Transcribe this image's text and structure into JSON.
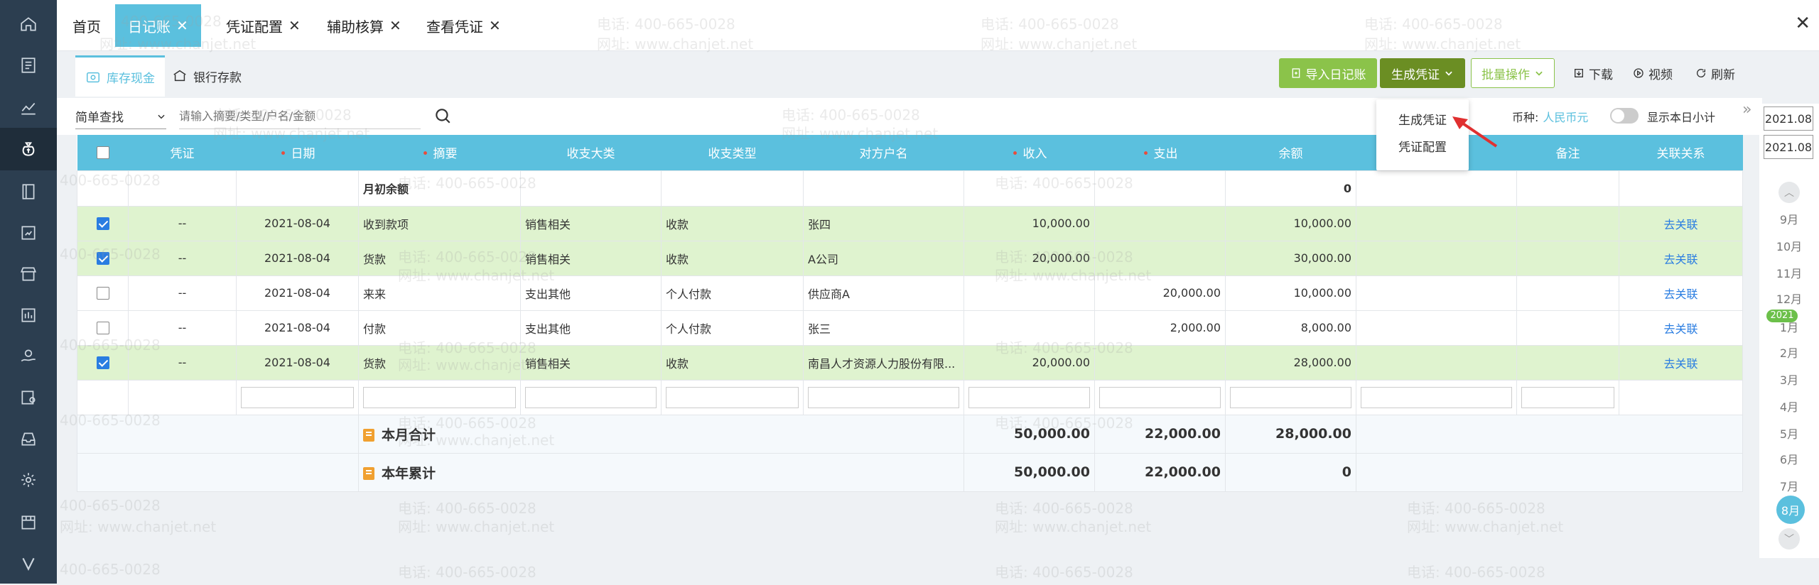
{
  "sidebar": {
    "items": [
      {
        "name": "home-icon"
      },
      {
        "name": "ledger-icon"
      },
      {
        "name": "chart-icon"
      },
      {
        "name": "money-bag-icon"
      },
      {
        "name": "book-icon"
      },
      {
        "name": "report-icon"
      },
      {
        "name": "store-icon"
      },
      {
        "name": "invoice-icon"
      },
      {
        "name": "hand-coin-icon"
      },
      {
        "name": "asset-icon"
      },
      {
        "name": "inbox-icon"
      },
      {
        "name": "gear-icon"
      },
      {
        "name": "film-icon"
      },
      {
        "name": "v-logo-icon"
      }
    ]
  },
  "tabs": [
    {
      "label": "首页",
      "closable": false
    },
    {
      "label": "日记账",
      "closable": true,
      "active": true
    },
    {
      "label": "凭证配置",
      "closable": true
    },
    {
      "label": "辅助核算",
      "closable": true
    },
    {
      "label": "查看凭证",
      "closable": true
    }
  ],
  "close_glyph": "✕",
  "subtabs": {
    "cash": "库存现金",
    "bank": "银行存款"
  },
  "toolbar": {
    "import": "导入日记账",
    "generate": "生成凭证",
    "batch": "批量操作",
    "download": "下载",
    "video": "视频",
    "refresh": "刷新"
  },
  "dropdown": {
    "items": [
      "生成凭证",
      "凭证配置"
    ]
  },
  "search": {
    "type": "简单查找",
    "placeholder": "请输入摘要/类型/户名/金额"
  },
  "currency": {
    "label": "币种:",
    "value": "人民币元"
  },
  "toggle_label": "显示本日小计",
  "table": {
    "headers": {
      "voucher": "凭证",
      "date": "日期",
      "summary": "摘要",
      "category": "收支大类",
      "type": "收支类型",
      "party": "对方户名",
      "income": "收入",
      "expense": "支出",
      "balance": "余额",
      "note": "备注",
      "relation": "关联关系"
    },
    "opening": {
      "label": "月初余额",
      "balance": "0"
    },
    "rows": [
      {
        "checked": true,
        "voucher": "--",
        "date": "2021-08-04",
        "summary": "收到款项",
        "category": "销售相关",
        "type": "收款",
        "party": "张四",
        "income": "10,000.00",
        "expense": "",
        "balance": "10,000.00",
        "relation": "去关联"
      },
      {
        "checked": true,
        "voucher": "--",
        "date": "2021-08-04",
        "summary": "货款",
        "category": "销售相关",
        "type": "收款",
        "party": "A公司",
        "income": "20,000.00",
        "expense": "",
        "balance": "30,000.00",
        "relation": "去关联"
      },
      {
        "checked": false,
        "voucher": "--",
        "date": "2021-08-04",
        "summary": "来来",
        "category": "支出其他",
        "type": "个人付款",
        "party": "供应商A",
        "income": "",
        "expense": "20,000.00",
        "balance": "10,000.00",
        "relation": "去关联"
      },
      {
        "checked": false,
        "voucher": "--",
        "date": "2021-08-04",
        "summary": "付款",
        "category": "支出其他",
        "type": "个人付款",
        "party": "张三",
        "income": "",
        "expense": "2,000.00",
        "balance": "8,000.00",
        "relation": "去关联"
      },
      {
        "checked": true,
        "voucher": "--",
        "date": "2021-08-04",
        "summary": "货款",
        "category": "销售相关",
        "type": "收款",
        "party": "南昌人才资源人力股份有限...",
        "income": "20,000.00",
        "expense": "",
        "balance": "28,000.00",
        "relation": "去关联"
      }
    ],
    "month_total": {
      "label": "本月合计",
      "income": "50,000.00",
      "expense": "22,000.00",
      "balance": "28,000.00"
    },
    "year_total": {
      "label": "本年累计",
      "income": "50,000.00",
      "expense": "22,000.00",
      "balance": "0"
    }
  },
  "datepanel": {
    "from": "2021.08",
    "to": "2021.08",
    "year_badge": "2021",
    "months_top": [
      "9月",
      "10月",
      "11月",
      "12月"
    ],
    "months_bottom": [
      "1月",
      "2月",
      "3月",
      "4月",
      "5月",
      "6月",
      "7月"
    ],
    "active_month": "8月"
  },
  "watermark": {
    "phone": "电话: 400-665-0028",
    "site": "网址: www.chanjet.net",
    "phone_short": "400-665-0028"
  }
}
